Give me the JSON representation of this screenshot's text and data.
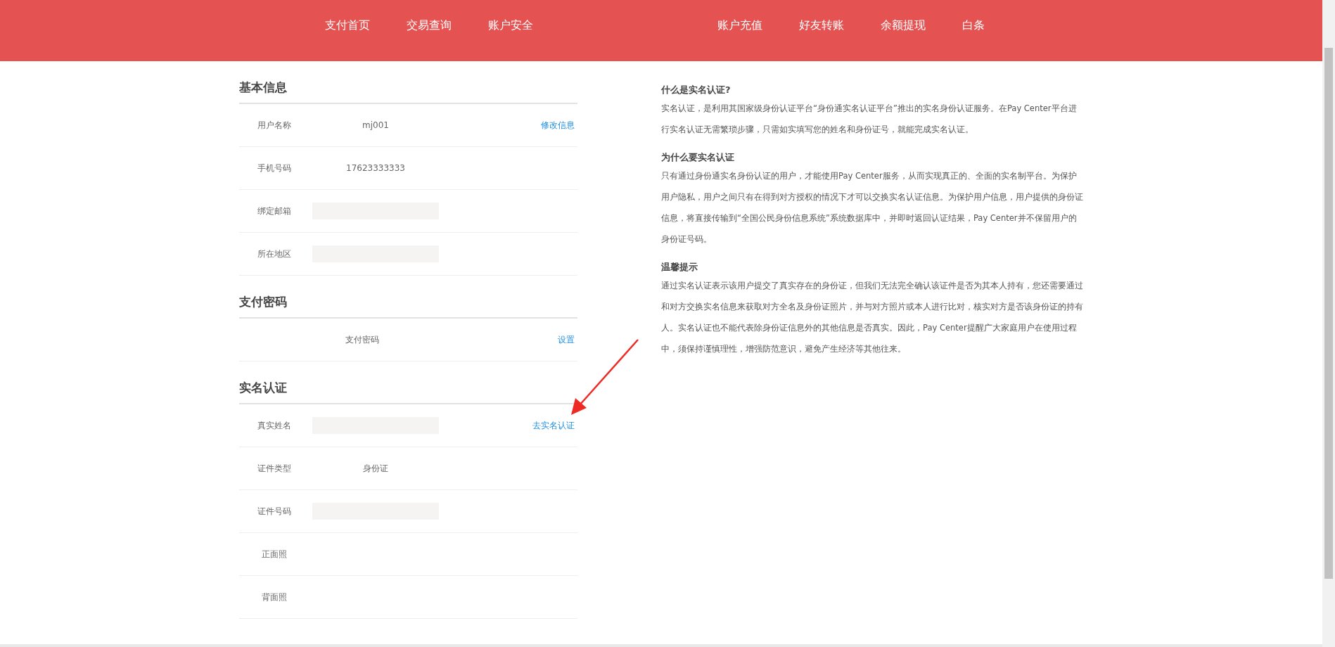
{
  "nav": {
    "left": [
      "支付首页",
      "交易查询",
      "账户安全"
    ],
    "right": [
      "账户充值",
      "好友转账",
      "余额提现",
      "白条"
    ]
  },
  "sections": [
    {
      "title": "基本信息",
      "rows": [
        {
          "kind": "text",
          "label": "用户名称",
          "value": "mj001",
          "action": "修改信息"
        },
        {
          "kind": "text",
          "label": "手机号码",
          "value": "17623333333"
        },
        {
          "kind": "redacted",
          "label": "绑定邮箱"
        },
        {
          "kind": "redacted",
          "label": "所在地区"
        }
      ]
    },
    {
      "title": "支付密码",
      "rows": [
        {
          "kind": "center",
          "value": "支付密码",
          "action": "设置"
        }
      ]
    },
    {
      "title": "实名认证",
      "rows": [
        {
          "kind": "redacted",
          "label": "真实姓名",
          "action": "去实名认证"
        },
        {
          "kind": "text",
          "label": "证件类型",
          "value": "身份证"
        },
        {
          "kind": "redacted",
          "label": "证件号码"
        },
        {
          "kind": "empty",
          "label": "正面照"
        },
        {
          "kind": "empty",
          "label": "背面照"
        }
      ]
    }
  ],
  "articles": [
    {
      "title": "什么是实名认证?",
      "body": "实名认证，是利用其国家级身份认证平台“身份通实名认证平台”推出的实名身份认证服务。在Pay Center平台进行实名认证无需繁琐步骤，只需如实填写您的姓名和身份证号，就能完成实名认证。"
    },
    {
      "title": "为什么要实名认证",
      "body": "只有通过身份通实名身份认证的用户，才能使用Pay Center服务，从而实现真正的、全面的实名制平台。为保护用户隐私，用户之间只有在得到对方授权的情况下才可以交换实名认证信息。为保护用户信息，用户提供的身份证信息，将直接传输到“全国公民身份信息系统”系统数据库中，并即时返回认证结果，Pay Center并不保留用户的身份证号码。"
    },
    {
      "title": "温馨提示",
      "body": "通过实名认证表示该用户提交了真实存在的身份证，但我们无法完全确认该证件是否为其本人持有，您还需要通过和对方交换实名信息来获取对方全名及身份证照片，并与对方照片或本人进行比对，核实对方是否该身份证的持有人。实名认证也不能代表除身份证信息外的其他信息是否真实。因此，Pay Center提醒广大家庭用户在使用过程中，须保持谨慎理性，增强防范意识，避免产生经济等其他往来。"
    }
  ]
}
